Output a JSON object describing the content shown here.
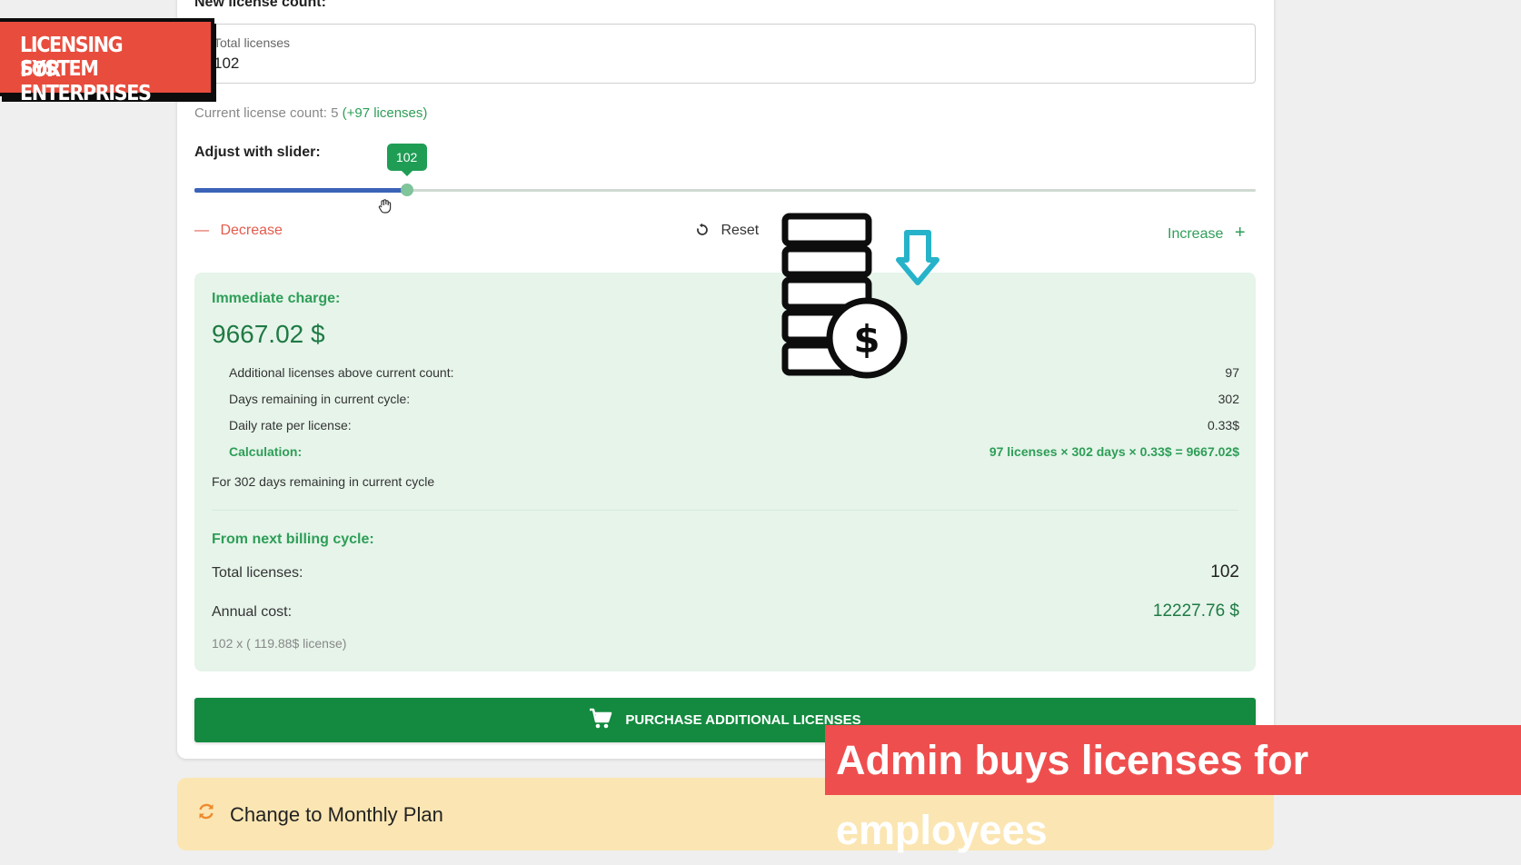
{
  "form": {
    "new_count_label": "New license count:",
    "field_label": "Total licenses",
    "field_value": "102",
    "current_count_prefix": "Current license count: 5",
    "current_count_delta": "(+97 licenses)",
    "adjust_label": "Adjust with slider:",
    "slider": {
      "value": 102,
      "label": "102",
      "fraction": 0.2
    },
    "decrease_label": "Decrease",
    "reset_label": "Reset",
    "increase_label": "Increase"
  },
  "immediate": {
    "label": "Immediate charge:",
    "amount": "9667.02 $",
    "rows": [
      {
        "label": "Additional licenses above current count:",
        "value": "97"
      },
      {
        "label": "Days remaining in current cycle:",
        "value": "302"
      },
      {
        "label": "Daily rate per license:",
        "value": "0.33$"
      },
      {
        "label": "Calculation:",
        "value": "97 licenses × 302 days × 0.33$ = 9667.02$"
      }
    ],
    "note": "For 302 days remaining in current cycle"
  },
  "next_cycle": {
    "label": "From next billing cycle:",
    "total_label": "Total licenses:",
    "total_value": "102",
    "annual_label": "Annual cost:",
    "annual_value": "12227.76 $",
    "formula": "102 x ( 119.88$ license)"
  },
  "purchase_label": "PURCHASE ADDITIONAL LICENSES",
  "monthly_title": "Change to Monthly Plan",
  "overlay": {
    "brand_line1": "LICENSING SYSTEM",
    "brand_line2": "FOR ENTERPRISES",
    "caption": "Admin buys licenses for employees"
  },
  "colors": {
    "accent_green": "#1f9d55",
    "button_green": "#138a3f",
    "decrease_red": "#e45b4c",
    "summary_bg": "#e6f4ea",
    "monthly_bg": "#fbe6b3",
    "caption_red": "#ef4e4e"
  },
  "icons": [
    "minus-icon",
    "reset-icon",
    "plus-icon",
    "cart-icon",
    "refresh-icon",
    "hand-cursor-icon",
    "coins-dollar-icon",
    "arrow-down-icon"
  ]
}
